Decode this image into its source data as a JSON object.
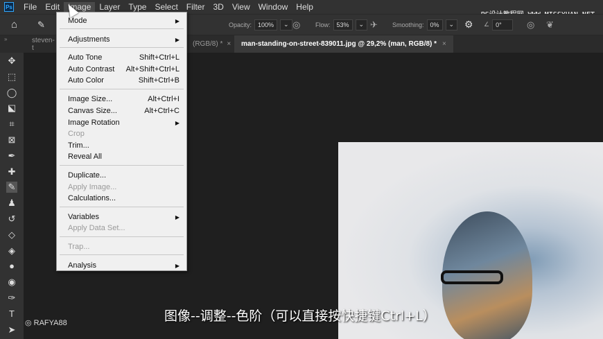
{
  "menubar": {
    "logo": "Ps",
    "items": [
      "File",
      "Edit",
      "Image",
      "Layer",
      "Type",
      "Select",
      "Filter",
      "3D",
      "View",
      "Window",
      "Help"
    ],
    "active": "Image"
  },
  "options": {
    "opacity_label": "Opacity:",
    "opacity": "100%",
    "flow_label": "Flow:",
    "flow": "53%",
    "smoothing_label": "Smoothing:",
    "smoothing": "0%",
    "angle": "0°"
  },
  "watermark": "PS设计教程网 WWW.MISSYUAN.NET",
  "tabs": [
    {
      "label": "steven-t",
      "active": false
    },
    {
      "label": "(RGB/8) *",
      "active": false
    },
    {
      "label": "man-standing-on-street-839011.jpg @ 29,2% (man, RGB/8) *",
      "active": true
    }
  ],
  "image_menu": [
    {
      "label": "Mode",
      "submenu": true
    },
    {
      "label": "Adjustments",
      "submenu": true
    },
    {
      "label": "Auto Tone",
      "shortcut": "Shift+Ctrl+L"
    },
    {
      "label": "Auto Contrast",
      "shortcut": "Alt+Shift+Ctrl+L"
    },
    {
      "label": "Auto Color",
      "shortcut": "Shift+Ctrl+B"
    },
    {
      "label": "Image Size...",
      "shortcut": "Alt+Ctrl+I"
    },
    {
      "label": "Canvas Size...",
      "shortcut": "Alt+Ctrl+C"
    },
    {
      "label": "Image Rotation",
      "submenu": true
    },
    {
      "label": "Crop",
      "disabled": true
    },
    {
      "label": "Trim..."
    },
    {
      "label": "Reveal All"
    },
    {
      "label": "Duplicate..."
    },
    {
      "label": "Apply Image...",
      "disabled": true
    },
    {
      "label": "Calculations..."
    },
    {
      "label": "Variables",
      "submenu": true
    },
    {
      "label": "Apply Data Set...",
      "disabled": true
    },
    {
      "label": "Trap...",
      "disabled": true
    },
    {
      "label": "Analysis",
      "submenu": true
    }
  ],
  "tools": [
    "move",
    "marquee",
    "lasso",
    "quick-select",
    "crop",
    "frame",
    "eyedropper",
    "healing",
    "brush",
    "stamp",
    "history-brush",
    "eraser",
    "paint-bucket",
    "blur",
    "dodge",
    "pen",
    "type",
    "path-select"
  ],
  "subtitle": "图像--调整--色阶（可以直接按快捷键Ctrl+L）",
  "handle": "RAFYA88"
}
